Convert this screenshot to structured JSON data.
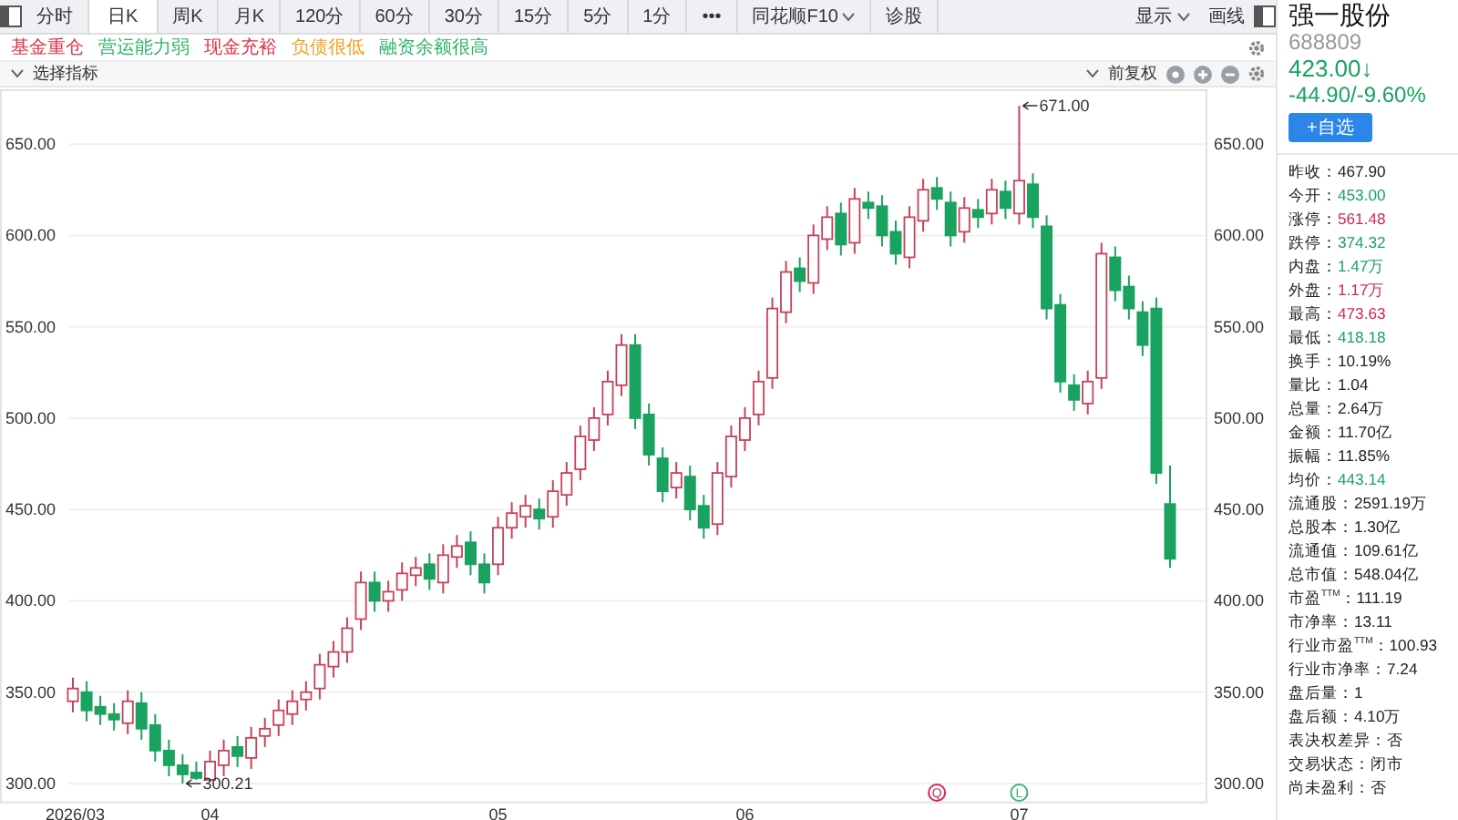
{
  "toolbar": {
    "tabs": [
      {
        "label": "分时",
        "selected": false
      },
      {
        "label": "日K",
        "selected": true
      },
      {
        "label": "周K",
        "selected": false
      },
      {
        "label": "月K",
        "selected": false
      },
      {
        "label": "120分",
        "selected": false
      },
      {
        "label": "60分",
        "selected": false
      },
      {
        "label": "30分",
        "selected": false
      },
      {
        "label": "15分",
        "selected": false
      },
      {
        "label": "5分",
        "selected": false
      },
      {
        "label": "1分",
        "selected": false
      },
      {
        "label": "•••",
        "selected": false
      },
      {
        "label": "同花顺F10",
        "selected": false
      },
      {
        "label": "诊股",
        "selected": false
      }
    ],
    "display_menu": "显示",
    "draw_button": "画线"
  },
  "tags": [
    {
      "label": "基金重仓",
      "color": "#e0314b"
    },
    {
      "label": "营运能力弱",
      "color": "#2fb36b"
    },
    {
      "label": "现金充裕",
      "color": "#e0314b"
    },
    {
      "label": "负债很低",
      "color": "#f0a020"
    },
    {
      "label": "融资余额很高",
      "color": "#2fb36b"
    }
  ],
  "indicator_bar": {
    "select_label": "选择指标",
    "adjust_label": "前复权"
  },
  "chart_data": {
    "type": "candlestick",
    "grid": true,
    "ylim": [
      290,
      680
    ],
    "yticks": [
      {
        "value": 300,
        "label": "300.00"
      },
      {
        "value": 350,
        "label": "350.00"
      },
      {
        "value": 400,
        "label": "400.00"
      },
      {
        "value": 450,
        "label": "450.00"
      },
      {
        "value": 500,
        "label": "500.00"
      },
      {
        "value": 550,
        "label": "550.00"
      },
      {
        "value": 600,
        "label": "600.00"
      },
      {
        "value": 650,
        "label": "650.00"
      }
    ],
    "categories": [
      "2026/03",
      null,
      null,
      null,
      null,
      null,
      null,
      null,
      null,
      null,
      "04",
      null,
      null,
      null,
      null,
      null,
      null,
      null,
      null,
      null,
      null,
      null,
      null,
      null,
      null,
      null,
      null,
      null,
      null,
      null,
      null,
      "05",
      null,
      null,
      null,
      null,
      null,
      null,
      null,
      null,
      null,
      null,
      null,
      null,
      null,
      null,
      null,
      null,
      null,
      "06",
      null,
      null,
      null,
      null,
      null,
      null,
      null,
      null,
      null,
      null,
      null,
      null,
      null,
      null,
      null,
      null,
      null,
      null,
      null,
      "07",
      null,
      null,
      null,
      null,
      null,
      null,
      null,
      null,
      null,
      null,
      null
    ],
    "ohlc": [
      [
        345,
        358,
        339,
        352
      ],
      [
        350,
        356,
        334,
        340
      ],
      [
        342,
        348,
        332,
        338
      ],
      [
        338,
        344,
        329,
        335
      ],
      [
        333,
        351,
        327,
        345
      ],
      [
        344,
        350,
        324,
        330
      ],
      [
        332,
        338,
        312,
        318
      ],
      [
        318,
        324,
        304,
        310
      ],
      [
        310,
        316,
        300,
        305
      ],
      [
        306,
        312,
        302,
        303
      ],
      [
        302,
        318,
        301,
        312
      ],
      [
        310,
        324,
        304,
        318
      ],
      [
        320,
        326,
        309,
        315
      ],
      [
        314,
        331,
        308,
        325
      ],
      [
        326,
        336,
        320,
        330
      ],
      [
        332,
        346,
        326,
        340
      ],
      [
        338,
        351,
        332,
        345
      ],
      [
        346,
        356,
        340,
        350
      ],
      [
        352,
        371,
        346,
        365
      ],
      [
        364,
        378,
        358,
        372
      ],
      [
        372,
        391,
        366,
        385
      ],
      [
        390,
        416,
        384,
        410
      ],
      [
        410,
        416,
        394,
        400
      ],
      [
        400,
        411,
        394,
        405
      ],
      [
        406,
        421,
        400,
        415
      ],
      [
        414,
        424,
        408,
        418
      ],
      [
        420,
        426,
        406,
        412
      ],
      [
        410,
        431,
        404,
        425
      ],
      [
        424,
        436,
        418,
        430
      ],
      [
        432,
        438,
        414,
        420
      ],
      [
        420,
        426,
        404,
        410
      ],
      [
        420,
        446,
        414,
        440
      ],
      [
        440,
        454,
        434,
        448
      ],
      [
        446,
        458,
        440,
        452
      ],
      [
        450,
        456,
        439,
        445
      ],
      [
        446,
        466,
        440,
        460
      ],
      [
        458,
        476,
        452,
        470
      ],
      [
        472,
        496,
        466,
        490
      ],
      [
        488,
        506,
        482,
        500
      ],
      [
        502,
        526,
        496,
        520
      ],
      [
        518,
        546,
        512,
        540
      ],
      [
        540,
        546,
        494,
        500
      ],
      [
        502,
        508,
        474,
        480
      ],
      [
        478,
        484,
        454,
        460
      ],
      [
        462,
        476,
        456,
        470
      ],
      [
        468,
        474,
        444,
        450
      ],
      [
        452,
        458,
        434,
        440
      ],
      [
        442,
        476,
        436,
        470
      ],
      [
        468,
        496,
        462,
        490
      ],
      [
        488,
        506,
        482,
        500
      ],
      [
        502,
        526,
        496,
        520
      ],
      [
        522,
        566,
        516,
        560
      ],
      [
        558,
        586,
        552,
        580
      ],
      [
        582,
        588,
        569,
        575
      ],
      [
        574,
        606,
        568,
        600
      ],
      [
        598,
        616,
        592,
        610
      ],
      [
        612,
        618,
        589,
        595
      ],
      [
        596,
        626,
        590,
        620
      ],
      [
        618,
        624,
        609,
        615
      ],
      [
        616,
        622,
        594,
        600
      ],
      [
        602,
        608,
        584,
        590
      ],
      [
        588,
        616,
        582,
        610
      ],
      [
        608,
        631,
        602,
        625
      ],
      [
        626,
        632,
        614,
        620
      ],
      [
        618,
        624,
        594,
        600
      ],
      [
        602,
        621,
        596,
        615
      ],
      [
        614,
        620,
        604,
        610
      ],
      [
        612,
        631,
        606,
        625
      ],
      [
        624,
        630,
        609,
        615
      ],
      [
        612,
        671,
        606,
        630
      ],
      [
        628,
        634,
        604,
        610
      ],
      [
        605,
        611,
        554,
        560
      ],
      [
        562,
        568,
        514,
        520
      ],
      [
        518,
        524,
        504,
        510
      ],
      [
        508,
        526,
        502,
        520
      ],
      [
        522,
        596,
        516,
        590
      ],
      [
        588,
        594,
        564,
        570
      ],
      [
        572,
        578,
        554,
        560
      ],
      [
        558,
        564,
        534,
        540
      ],
      [
        560,
        566,
        464,
        470
      ],
      [
        453,
        474,
        418,
        423
      ]
    ],
    "annotations": [
      "671.00",
      "300.21"
    ]
  },
  "event_markers": [
    {
      "label": "Q",
      "color": "#d0275a"
    },
    {
      "label": "L",
      "color": "#3cb371"
    }
  ],
  "right_axis_labels": [
    "650.00",
    "600.00",
    "550.00",
    "500.00",
    "450.00",
    "400.00",
    "350.00",
    "300.00"
  ],
  "quote": {
    "name": "强一股份",
    "code": "688809",
    "price": "423.00↓",
    "change": "-44.90/-9.60%",
    "watch_button": "+自选",
    "stats": [
      {
        "label": "昨收：",
        "value": "467.90",
        "color": "#222222"
      },
      {
        "label": "今开：",
        "value": "453.00",
        "color": "#1aa260"
      },
      {
        "label": "涨停：",
        "value": "561.48",
        "color": "#d0275a"
      },
      {
        "label": "跌停：",
        "value": "374.32",
        "color": "#1aa260"
      },
      {
        "label": "内盘：",
        "value": "1.47万",
        "color": "#1aa260"
      },
      {
        "label": "外盘：",
        "value": "1.17万",
        "color": "#d0275a"
      },
      {
        "label": "最高：",
        "value": "473.63",
        "color": "#d0275a"
      },
      {
        "label": "最低：",
        "value": "418.18",
        "color": "#1aa260"
      },
      {
        "label": "换手：",
        "value": "10.19%",
        "color": "#222222"
      },
      {
        "label": "量比：",
        "value": "1.04",
        "color": "#222222"
      },
      {
        "label": "总量：",
        "value": "2.64万",
        "color": "#222222"
      },
      {
        "label": "金额：",
        "value": "11.70亿",
        "color": "#222222"
      },
      {
        "label": "振幅：",
        "value": "11.85%",
        "color": "#222222"
      },
      {
        "label": "均价：",
        "value": "443.14",
        "color": "#1aa260"
      },
      {
        "label": "流通股：",
        "value": "2591.19万",
        "color": "#222222"
      },
      {
        "label": "总股本：",
        "value": "1.30亿",
        "color": "#222222"
      },
      {
        "label": "流通值：",
        "value": "109.61亿",
        "color": "#222222"
      },
      {
        "label": "总市值：",
        "value": "548.04亿",
        "color": "#222222"
      },
      {
        "label": "市盈$^{TTM}$：",
        "value": "111.19",
        "color": "#222222"
      },
      {
        "label": "市净率：",
        "value": "13.11",
        "color": "#222222"
      },
      {
        "label": "行业市盈$^{TTM}$：",
        "value": "100.93",
        "color": "#222222"
      },
      {
        "label": "行业市净率：",
        "value": "7.24",
        "color": "#222222"
      },
      {
        "label": "盘后量：",
        "value": "1",
        "color": "#222222"
      },
      {
        "label": "盘后额：",
        "value": "4.10万",
        "color": "#222222"
      },
      {
        "label": "表决权差异：",
        "value": "否",
        "color": "#222222"
      },
      {
        "label": "交易状态：",
        "value": "闭市",
        "color": "#222222"
      },
      {
        "label": "尚未盈利：",
        "value": "否",
        "color": "#222222"
      }
    ]
  }
}
